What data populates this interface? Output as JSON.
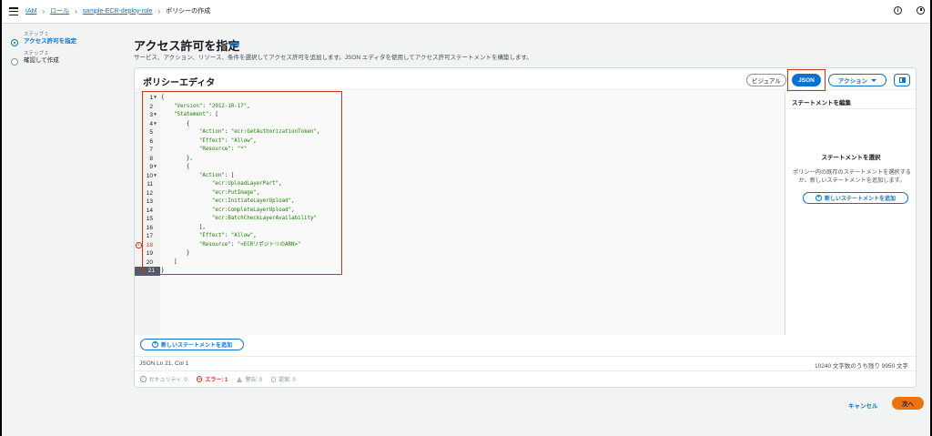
{
  "breadcrumb": {
    "items": [
      "IAM",
      "ロール",
      "sample-ECR-deploy-role"
    ],
    "current": "ポリシーの作成"
  },
  "steps": [
    {
      "num": "ステップ 1",
      "title": "アクセス許可を指定",
      "active": true
    },
    {
      "num": "ステップ 2",
      "title": "確認して作成",
      "active": false
    }
  ],
  "header": {
    "title": "アクセス許可を指定",
    "info": "情報",
    "description": "サービス、アクション、リソース、条件を選択してアクセス許可を追加します。JSON エディタを使用してアクセス許可ステートメントを構築します。"
  },
  "editor": {
    "title": "ポリシーエディタ",
    "visual_label": "ビジュアル",
    "json_label": "JSON",
    "action_label": "アクション",
    "add_statement_label": "新しいステートメントを追加",
    "status_left": "JSON   Ln 21, Col 1",
    "status_right": "10240 文字数のうち残り 9950 文字",
    "validation": {
      "security": "セキュリティ: 0",
      "errors": "エラー: 1",
      "warnings": "警告: 0",
      "suggestions": "提案: 0"
    }
  },
  "code_lines": [
    {
      "n": "1",
      "fold": true,
      "text": "{"
    },
    {
      "n": "2",
      "text": "    <s>\"Version\"</s>: <s>\"2012-10-17\"</s>,"
    },
    {
      "n": "3",
      "fold": true,
      "text": "    <s>\"Statement\"</s>: ["
    },
    {
      "n": "4",
      "fold": true,
      "text": "        {"
    },
    {
      "n": "5",
      "text": "            <s>\"Action\"</s>: <s>\"ecr:GetAuthorizationToken\"</s>,"
    },
    {
      "n": "6",
      "text": "            <s>\"Effect\"</s>: <s>\"Allow\"</s>,"
    },
    {
      "n": "7",
      "text": "            <s>\"Resource\"</s>: <s>\"*\"</s>"
    },
    {
      "n": "8",
      "text": "        },"
    },
    {
      "n": "9",
      "fold": true,
      "text": "        {"
    },
    {
      "n": "10",
      "fold": true,
      "text": "            <s>\"Action\"</s>: ["
    },
    {
      "n": "11",
      "text": "                <s>\"ecr:UploadLayerPart\"</s>,"
    },
    {
      "n": "12",
      "text": "                <s>\"ecr:PutImage\"</s>,"
    },
    {
      "n": "13",
      "text": "                <s>\"ecr:InitiateLayerUpload\"</s>,"
    },
    {
      "n": "14",
      "text": "                <s>\"ecr:CompleteLayerUpload\"</s>,"
    },
    {
      "n": "15",
      "text": "                <s>\"ecr:BatchCheckLayerAvailability\"</s>"
    },
    {
      "n": "16",
      "text": "            ],"
    },
    {
      "n": "17",
      "text": "            <s>\"Effect\"</s>: <s>\"Allow\"</s>,"
    },
    {
      "n": "18",
      "error": true,
      "text": "            <s>\"Resource\"</s>: <s>\"<ECRリポジトリのARN>\"</s>"
    },
    {
      "n": "19",
      "text": "        }"
    },
    {
      "n": "20",
      "text": "    ]"
    },
    {
      "n": "21",
      "active": true,
      "text": "}"
    }
  ],
  "side_panel": {
    "title": "ステートメントを編集",
    "empty_title": "ステートメントを選択",
    "empty_desc": "ポリシー内の既存のステートメントを選択するか、新しいステートメントを追加します。",
    "add_label": "新しいステートメントを追加"
  },
  "footer": {
    "cancel": "キャンセル",
    "next": "次へ"
  }
}
